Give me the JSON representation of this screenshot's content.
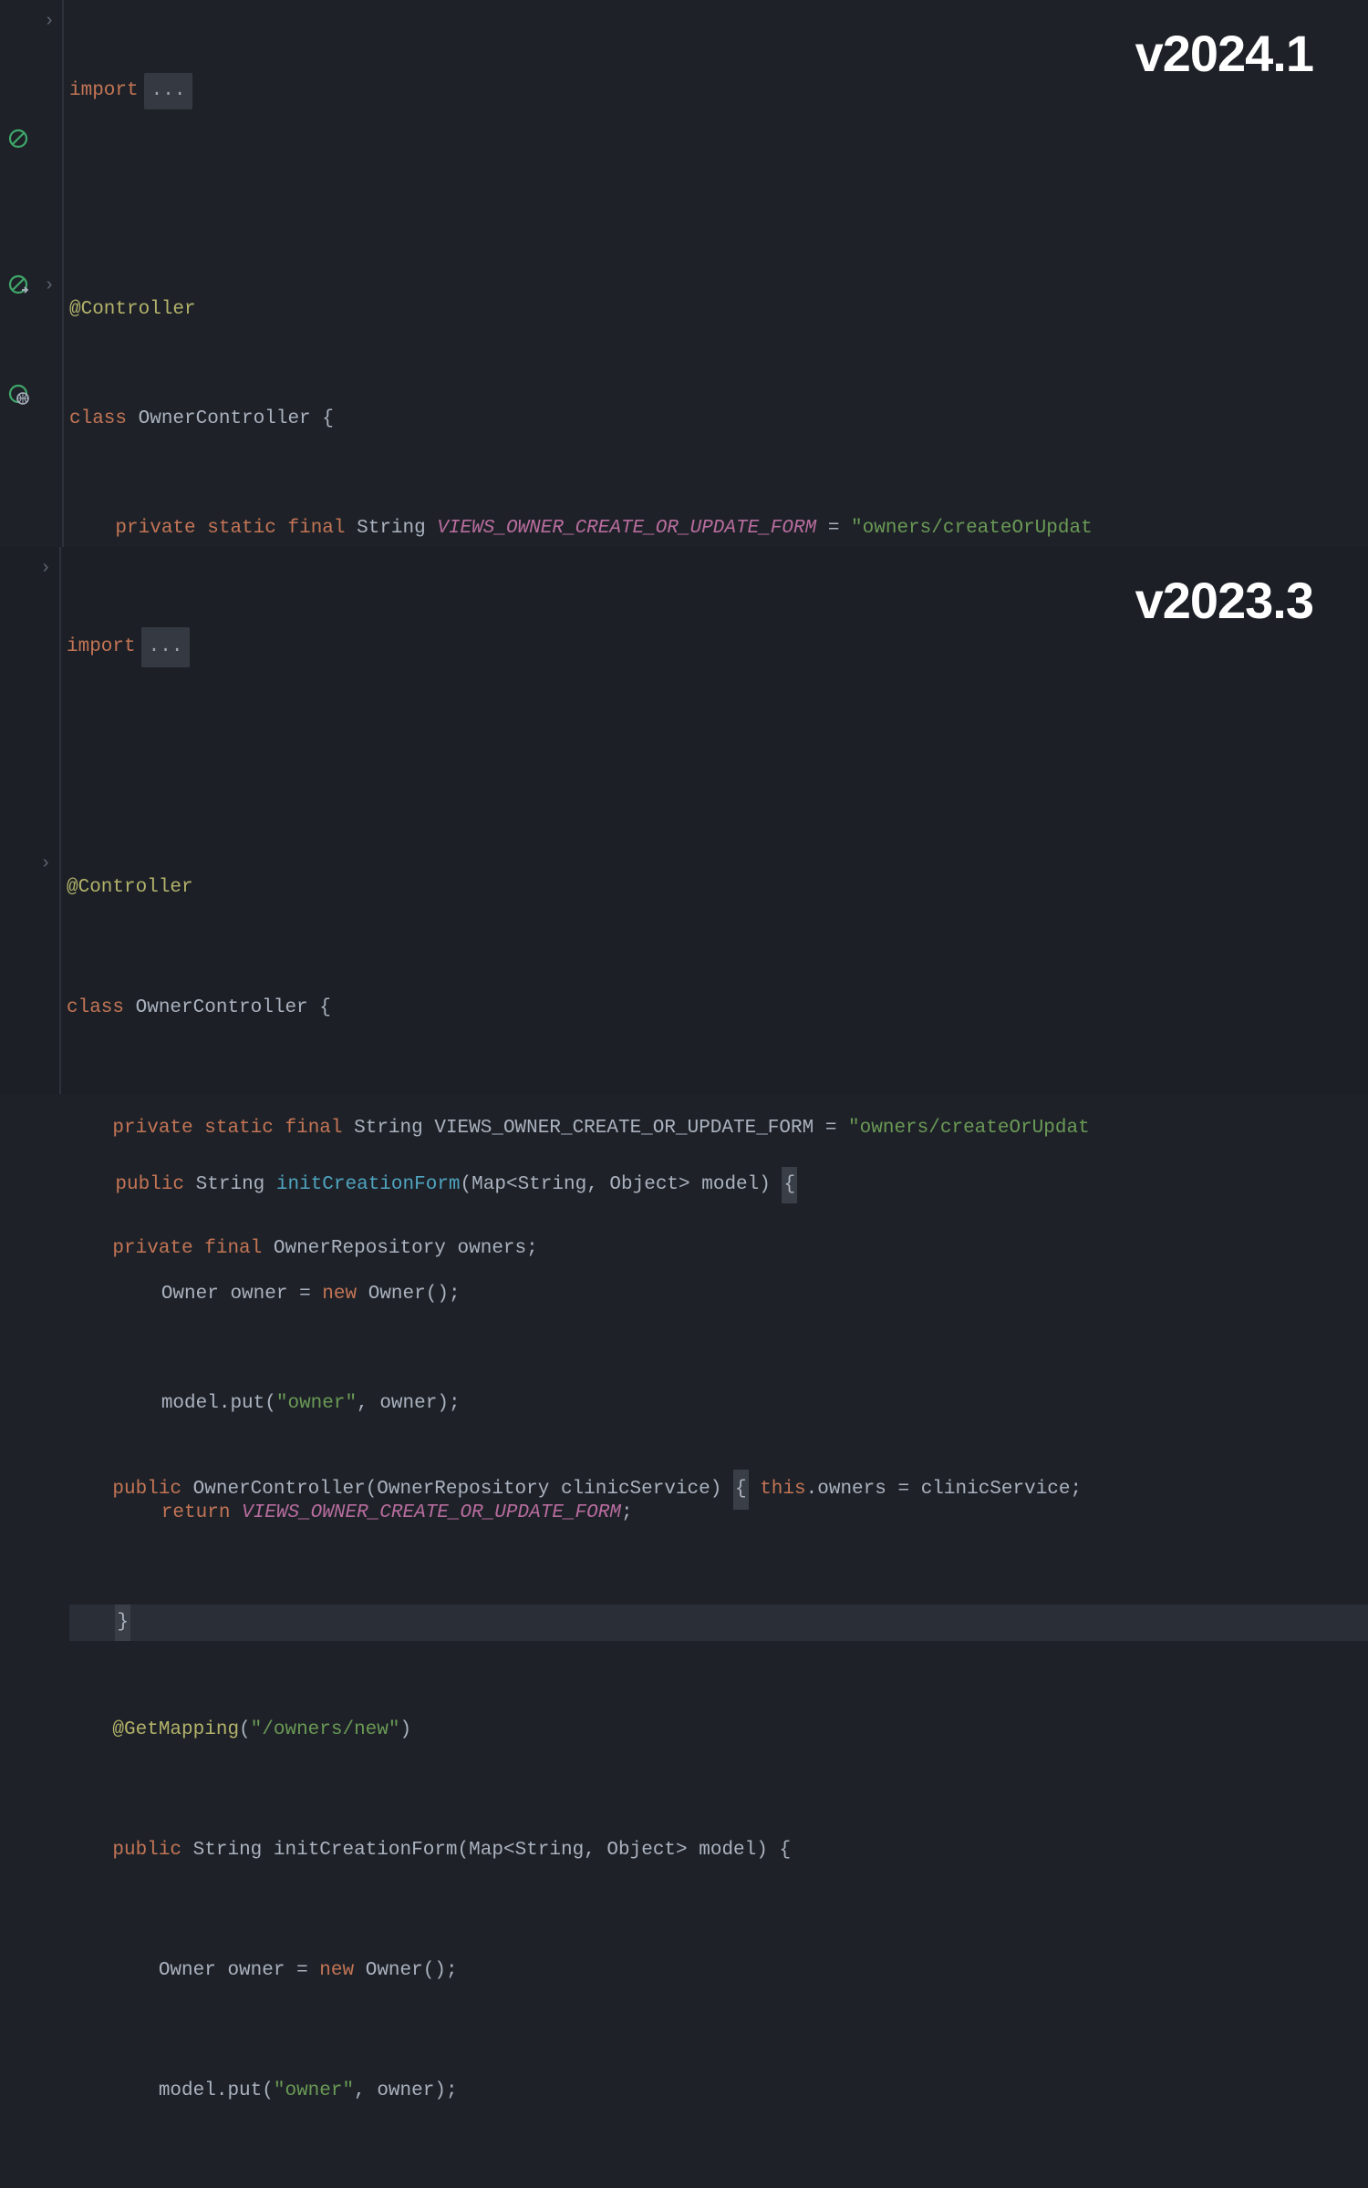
{
  "versions": {
    "top": "v2024.1",
    "bottom": "v2023.3"
  },
  "tokens": {
    "import": "import",
    "dots": "...",
    "ann_controller": "@Controller",
    "class": "class",
    "OwnerController": "OwnerController",
    "lbrace": "{",
    "rbrace": "}",
    "private": "private",
    "static": "static",
    "final": "final",
    "String": "String",
    "const_name": "VIEWS_OWNER_CREATE_OR_UPDATE_FORM",
    "eq": "=",
    "str_path": "\"owners/createOrUpdat",
    "OwnerRepository": "OwnerRepository",
    "owners": "owners",
    "semi": ";",
    "public": "public",
    "lparen": "(",
    "rparen": ")",
    "clinicService": "clinicService",
    "this": "this",
    "dot": ".",
    "ann_get": "@GetMapping",
    "str_route": "\"/owners/new\"",
    "initCreationForm": "initCreationForm",
    "Map": "Map",
    "lt": "<",
    "gt": ">",
    "comma": ",",
    "Object": "Object",
    "model": "model",
    "Owner": "Owner",
    "owner": "owner",
    "new": "new",
    "put": "put",
    "str_owner": "\"owner\"",
    "return": "return"
  }
}
